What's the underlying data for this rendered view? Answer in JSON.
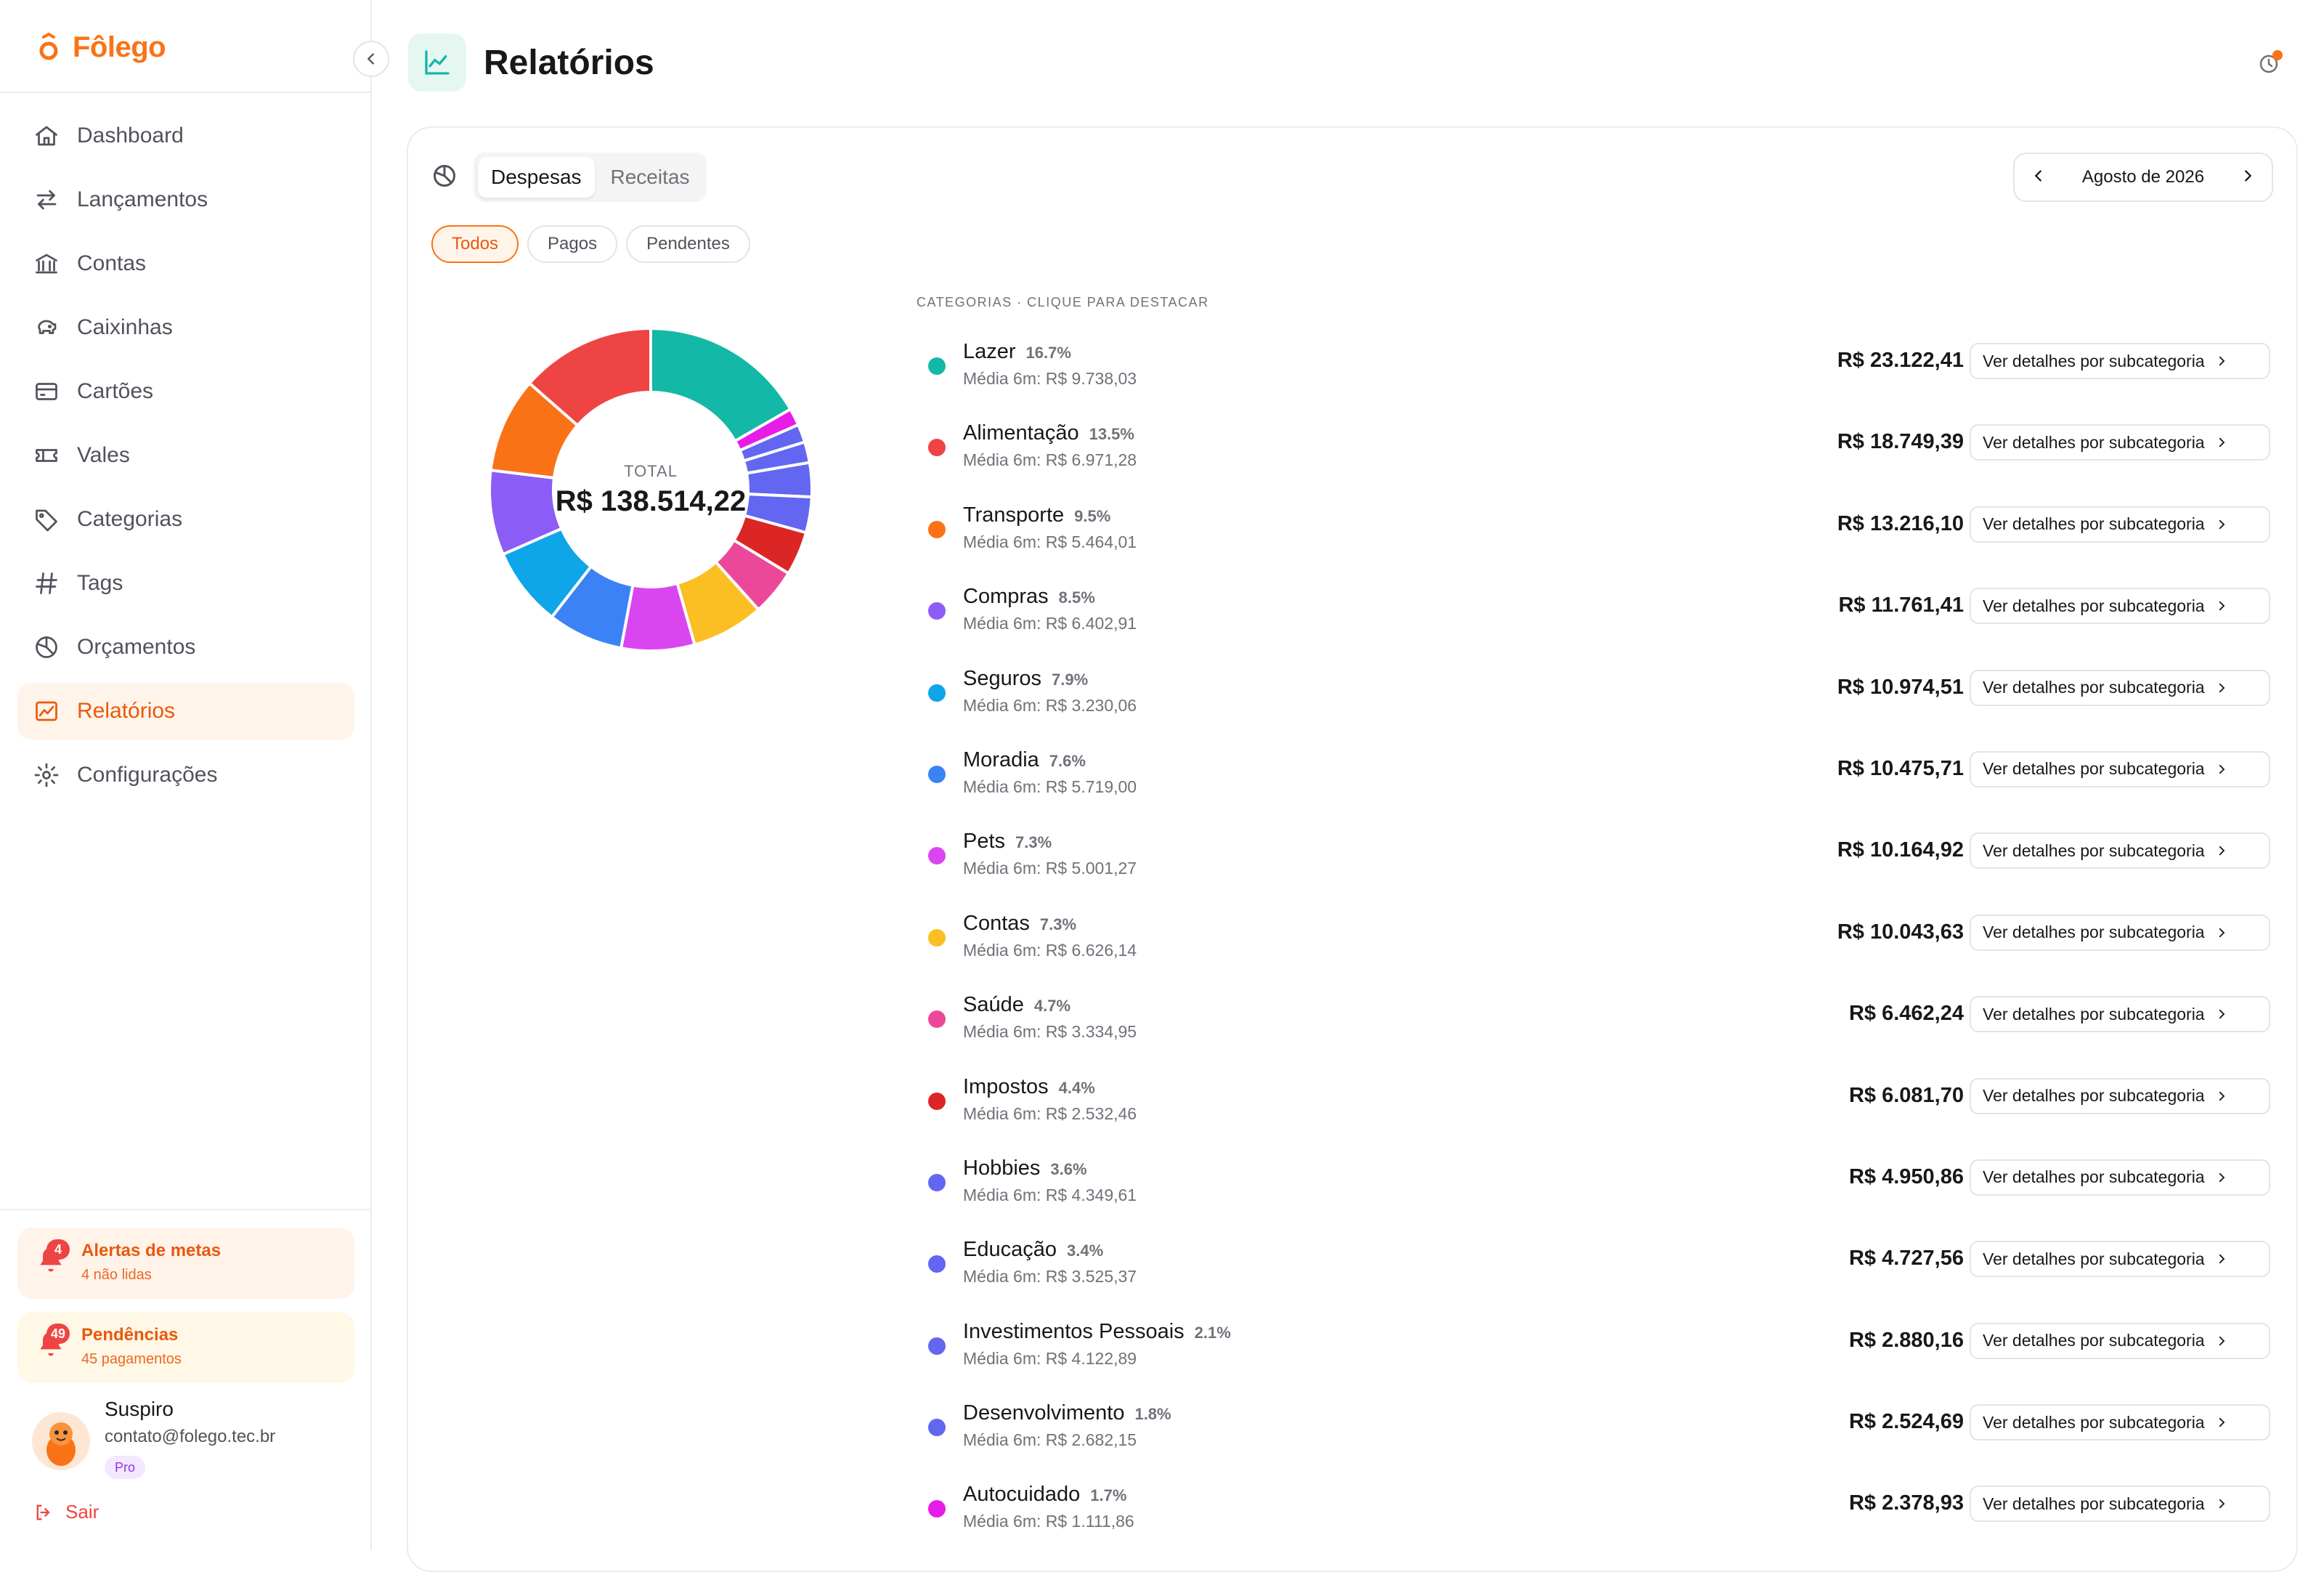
{
  "brand": {
    "name": "Fôlego",
    "color": "#f97316"
  },
  "nav": [
    {
      "label": "Dashboard",
      "icon": "home-icon",
      "active": false
    },
    {
      "label": "Lançamentos",
      "icon": "arrows-swap-icon",
      "active": false
    },
    {
      "label": "Contas",
      "icon": "bank-icon",
      "active": false
    },
    {
      "label": "Caixinhas",
      "icon": "piggy-bank-icon",
      "active": false
    },
    {
      "label": "Cartões",
      "icon": "credit-card-icon",
      "active": false
    },
    {
      "label": "Vales",
      "icon": "ticket-icon",
      "active": false
    },
    {
      "label": "Categorias",
      "icon": "tag-icon",
      "active": false
    },
    {
      "label": "Tags",
      "icon": "hash-icon",
      "active": false
    },
    {
      "label": "Orçamentos",
      "icon": "pie-chart-icon",
      "active": false
    },
    {
      "label": "Relatórios",
      "icon": "chart-line-icon",
      "active": true
    },
    {
      "label": "Configurações",
      "icon": "gear-icon",
      "active": false
    }
  ],
  "alerts": {
    "goals": {
      "title": "Alertas de metas",
      "subtitle": "4 não lidas",
      "badge": "4"
    },
    "pending": {
      "title": "Pendências",
      "subtitle": "45 pagamentos",
      "badge": "49"
    }
  },
  "user": {
    "name": "Suspiro",
    "email": "contato@folego.tec.br",
    "plan": "Pro"
  },
  "logout_label": "Sair",
  "header": {
    "title": "Relatórios"
  },
  "tabs": {
    "expenses": "Despesas",
    "income": "Receitas",
    "active": "expenses"
  },
  "month": {
    "label": "Agosto de 2026"
  },
  "filters": [
    {
      "label": "Todos",
      "active": true
    },
    {
      "label": "Pagos",
      "active": false
    },
    {
      "label": "Pendentes",
      "active": false
    }
  ],
  "total": {
    "label": "TOTAL",
    "value": "R$ 138.514,22"
  },
  "categories_header": "CATEGORIAS · CLIQUE PARA DESTACAR",
  "details_label": "Ver detalhes por subcategoria",
  "chart_data": {
    "type": "pie",
    "unit": "R$",
    "categories": [
      "Lazer",
      "Alimentação",
      "Transporte",
      "Compras",
      "Seguros",
      "Moradia",
      "Pets",
      "Contas",
      "Saúde",
      "Impostos",
      "Hobbies",
      "Educação",
      "Investimentos Pessoais",
      "Desenvolvimento",
      "Autocuidado"
    ],
    "values": [
      23122.41,
      18749.39,
      13216.1,
      11761.41,
      10974.51,
      10475.71,
      10164.92,
      10043.63,
      6462.24,
      6081.7,
      4950.86,
      4727.56,
      2880.16,
      2524.69,
      2378.93
    ],
    "total": 138514.22
  },
  "categories": [
    {
      "name": "Lazer",
      "pct": "16.7%",
      "avg": "Média 6m: R$ 9.738,03",
      "value": "R$ 23.122,41",
      "color": "#14b8a6"
    },
    {
      "name": "Alimentação",
      "pct": "13.5%",
      "avg": "Média 6m: R$ 6.971,28",
      "value": "R$ 18.749,39",
      "color": "#ef4444"
    },
    {
      "name": "Transporte",
      "pct": "9.5%",
      "avg": "Média 6m: R$ 5.464,01",
      "value": "R$ 13.216,10",
      "color": "#f97316"
    },
    {
      "name": "Compras",
      "pct": "8.5%",
      "avg": "Média 6m: R$ 6.402,91",
      "value": "R$ 11.761,41",
      "color": "#8b5cf6"
    },
    {
      "name": "Seguros",
      "pct": "7.9%",
      "avg": "Média 6m: R$ 3.230,06",
      "value": "R$ 10.974,51",
      "color": "#0ea5e9"
    },
    {
      "name": "Moradia",
      "pct": "7.6%",
      "avg": "Média 6m: R$ 5.719,00",
      "value": "R$ 10.475,71",
      "color": "#3b82f6"
    },
    {
      "name": "Pets",
      "pct": "7.3%",
      "avg": "Média 6m: R$ 5.001,27",
      "value": "R$ 10.164,92",
      "color": "#d946ef"
    },
    {
      "name": "Contas",
      "pct": "7.3%",
      "avg": "Média 6m: R$ 6.626,14",
      "value": "R$ 10.043,63",
      "color": "#fbbf24"
    },
    {
      "name": "Saúde",
      "pct": "4.7%",
      "avg": "Média 6m: R$ 3.334,95",
      "value": "R$ 6.462,24",
      "color": "#ec4899"
    },
    {
      "name": "Impostos",
      "pct": "4.4%",
      "avg": "Média 6m: R$ 2.532,46",
      "value": "R$ 6.081,70",
      "color": "#dc2626"
    },
    {
      "name": "Hobbies",
      "pct": "3.6%",
      "avg": "Média 6m: R$ 4.349,61",
      "value": "R$ 4.950,86",
      "color": "#6366f1"
    },
    {
      "name": "Educação",
      "pct": "3.4%",
      "avg": "Média 6m: R$ 3.525,37",
      "value": "R$ 4.727,56",
      "color": "#6366f1"
    },
    {
      "name": "Investimentos Pessoais",
      "pct": "2.1%",
      "avg": "Média 6m: R$ 4.122,89",
      "value": "R$ 2.880,16",
      "color": "#6366f1"
    },
    {
      "name": "Desenvolvimento",
      "pct": "1.8%",
      "avg": "Média 6m: R$ 2.682,15",
      "value": "R$ 2.524,69",
      "color": "#6366f1"
    },
    {
      "name": "Autocuidado",
      "pct": "1.7%",
      "avg": "Média 6m: R$ 1.111,86",
      "value": "R$ 2.378,93",
      "color": "#e81ce8"
    }
  ],
  "donut_segments": [
    {
      "value": 23122.41,
      "color": "#14b8a6"
    },
    {
      "value": 2378.93,
      "color": "#e81ce8"
    },
    {
      "value": 2524.69,
      "color": "#6366f1"
    },
    {
      "value": 2880.16,
      "color": "#6366f1"
    },
    {
      "value": 4727.56,
      "color": "#6366f1"
    },
    {
      "value": 4950.86,
      "color": "#6366f1"
    },
    {
      "value": 6081.7,
      "color": "#dc2626"
    },
    {
      "value": 6462.24,
      "color": "#ec4899"
    },
    {
      "value": 10043.63,
      "color": "#fbbf24"
    },
    {
      "value": 10164.92,
      "color": "#d946ef"
    },
    {
      "value": 10475.71,
      "color": "#3b82f6"
    },
    {
      "value": 10974.51,
      "color": "#0ea5e9"
    },
    {
      "value": 11761.41,
      "color": "#8b5cf6"
    },
    {
      "value": 13216.1,
      "color": "#f97316"
    },
    {
      "value": 18749.39,
      "color": "#ef4444"
    }
  ]
}
